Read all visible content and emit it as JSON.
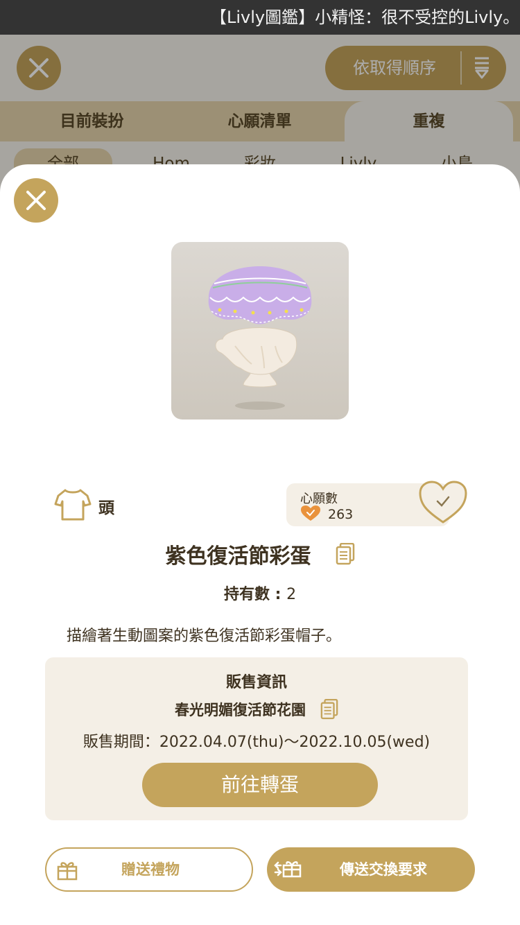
{
  "status_bar": {
    "marquee_text": "【Livly圖鑑】小精怪：很不受控的Livly。由"
  },
  "background": {
    "sort_label": "依取得順序",
    "tabs": [
      {
        "label": "目前裝扮"
      },
      {
        "label": "心願清單"
      },
      {
        "label": "重複"
      }
    ],
    "subtabs": [
      {
        "label": "全部"
      },
      {
        "label": "Hom"
      },
      {
        "label": "彩妝"
      },
      {
        "label": "Livly"
      },
      {
        "label": "小島"
      }
    ]
  },
  "item": {
    "category": "頭",
    "wishlist_label": "心願數",
    "wishlist_count": "263",
    "name": "紫色復活節彩蛋",
    "owned_label": "持有數 : ",
    "owned_count": "2",
    "description": "描繪著生動圖案的紫色復活節彩蛋帽子。"
  },
  "sale_info": {
    "title": "販售資訊",
    "event_name": "春光明媚復活節花園",
    "period": "販售期間：2022.04.07(thu)～2022.10.05(wed)",
    "gacha_button": "前往轉蛋"
  },
  "actions": {
    "gift_button": "贈送禮物",
    "trade_button": "傳送交換要求"
  },
  "colors": {
    "accent_gold": "#c4a45c",
    "panel_beige": "#f4efe6",
    "tab_tan": "#e6d4ad",
    "text_brown": "#3e3220",
    "heart_orange": "#e9923c"
  }
}
